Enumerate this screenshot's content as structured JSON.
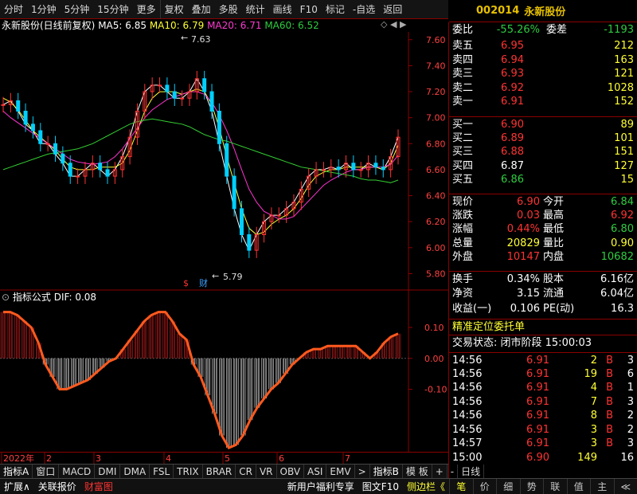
{
  "toolbar": {
    "items": [
      "分时",
      "1分钟",
      "5分钟",
      "15分钟",
      "更多",
      "复权",
      "叠加",
      "多股",
      "统计",
      "画线",
      "F10",
      "标记",
      "-自选",
      "返回"
    ]
  },
  "stock": {
    "code": "002014",
    "name": "永新股份"
  },
  "chart_header": {
    "title": "永新股份(日线前复权)",
    "ma5_label": "MA5: 6.85",
    "ma10_label": "MA10: 6.79",
    "ma20_label": "MA20: 6.71",
    "ma60_label": "MA60: 6.52"
  },
  "chart_annotations": {
    "high": "7.63",
    "low": "5.79",
    "marker_s": "$",
    "marker_cai": "财"
  },
  "indicator_header": {
    "label": "指标公式",
    "dif": "DIF: 0.08"
  },
  "colors": {
    "up": "#ff3333",
    "down": "#00d0ff",
    "ma5": "#ffffff",
    "ma10": "#ffff33",
    "ma20": "#ff33d0",
    "ma60": "#33cc33",
    "macd_pos": "#ff5a1e",
    "macd_neg": "#00a0ff"
  },
  "chart_data": {
    "type": "line",
    "y_ticks": [
      "7.60",
      "7.40",
      "7.20",
      "7.00",
      "6.80",
      "6.60",
      "6.40",
      "6.20",
      "6.00",
      "5.80"
    ],
    "ylim": [
      5.76,
      7.66
    ],
    "x_tick_labels": [
      "2022年",
      "2",
      "3",
      "4",
      "5",
      "6",
      "7"
    ],
    "series": [
      {
        "name": "MA5",
        "values": [
          7.1,
          7.13,
          7.05,
          6.95,
          6.9,
          6.8,
          6.8,
          6.72,
          6.65,
          6.55,
          6.55,
          6.6,
          6.65,
          6.6,
          6.55,
          6.6,
          6.7,
          6.85,
          7.05,
          7.2,
          7.25,
          7.25,
          7.2,
          7.15,
          7.15,
          7.2,
          7.3,
          7.2,
          7.05,
          6.8,
          6.55,
          6.3,
          6.1,
          5.98,
          6.1,
          6.2,
          6.25,
          6.25,
          6.3,
          6.35,
          6.45,
          6.55,
          6.6,
          6.6,
          6.62,
          6.6,
          6.65,
          6.6,
          6.6,
          6.65,
          6.62,
          6.6,
          6.7,
          6.85
        ]
      },
      {
        "name": "MA10",
        "values": [
          7.15,
          7.12,
          7.06,
          6.98,
          6.9,
          6.85,
          6.8,
          6.75,
          6.68,
          6.62,
          6.6,
          6.6,
          6.6,
          6.62,
          6.62,
          6.62,
          6.65,
          6.75,
          6.9,
          7.05,
          7.15,
          7.2,
          7.2,
          7.2,
          7.18,
          7.2,
          7.22,
          7.2,
          7.1,
          6.92,
          6.7,
          6.5,
          6.3,
          6.15,
          6.1,
          6.12,
          6.18,
          6.22,
          6.25,
          6.3,
          6.38,
          6.48,
          6.55,
          6.58,
          6.6,
          6.6,
          6.62,
          6.62,
          6.62,
          6.62,
          6.62,
          6.6,
          6.65,
          6.79
        ]
      },
      {
        "name": "MA20",
        "values": [
          7.05,
          7.0,
          6.96,
          6.92,
          6.88,
          6.84,
          6.8,
          6.76,
          6.72,
          6.68,
          6.66,
          6.65,
          6.64,
          6.65,
          6.66,
          6.7,
          6.76,
          6.84,
          6.92,
          7.0,
          7.06,
          7.1,
          7.14,
          7.16,
          7.18,
          7.2,
          7.2,
          7.18,
          7.12,
          7.02,
          6.9,
          6.76,
          6.6,
          6.45,
          6.35,
          6.28,
          6.25,
          6.22,
          6.22,
          6.24,
          6.3,
          6.36,
          6.42,
          6.48,
          6.52,
          6.55,
          6.58,
          6.6,
          6.6,
          6.62,
          6.62,
          6.62,
          6.64,
          6.71
        ]
      },
      {
        "name": "MA60",
        "values": [
          6.6,
          6.62,
          6.64,
          6.66,
          6.68,
          6.7,
          6.72,
          6.73,
          6.74,
          6.75,
          6.76,
          6.78,
          6.8,
          6.83,
          6.86,
          6.89,
          6.92,
          6.95,
          6.97,
          6.98,
          6.99,
          6.98,
          6.97,
          6.96,
          6.95,
          6.93,
          6.9,
          6.87,
          6.85,
          6.83,
          6.82,
          6.8,
          6.78,
          6.76,
          6.74,
          6.72,
          6.7,
          6.68,
          6.66,
          6.64,
          6.62,
          6.61,
          6.6,
          6.59,
          6.58,
          6.57,
          6.56,
          6.55,
          6.53,
          6.52,
          6.52,
          6.51,
          6.5,
          6.52
        ]
      }
    ]
  },
  "macd_data": {
    "type": "bar",
    "y_ticks": [
      "0.10",
      "0.00",
      "-0.10"
    ],
    "ylim": [
      -0.3,
      0.18
    ],
    "values": [
      0.15,
      0.15,
      0.14,
      0.12,
      0.1,
      0.05,
      -0.02,
      -0.06,
      -0.1,
      -0.1,
      -0.09,
      -0.08,
      -0.07,
      -0.05,
      -0.03,
      -0.01,
      0.0,
      0.03,
      0.06,
      0.09,
      0.12,
      0.14,
      0.15,
      0.15,
      0.12,
      0.08,
      0.06,
      -0.02,
      -0.06,
      -0.12,
      -0.18,
      -0.25,
      -0.29,
      -0.28,
      -0.25,
      -0.2,
      -0.16,
      -0.13,
      -0.1,
      -0.08,
      -0.05,
      -0.02,
      0.0,
      0.02,
      0.03,
      0.03,
      0.04,
      0.04,
      0.04,
      0.04,
      0.04,
      0.02,
      0.0,
      0.02,
      0.05,
      0.07,
      0.08
    ]
  },
  "right": {
    "weibi_label": "委比",
    "weibi": "-55.26%",
    "weicha_label": "委差",
    "weicha": "-1193",
    "asks": [
      {
        "label": "卖五",
        "price": "6.95",
        "vol": "212"
      },
      {
        "label": "卖四",
        "price": "6.94",
        "vol": "163"
      },
      {
        "label": "卖三",
        "price": "6.93",
        "vol": "121"
      },
      {
        "label": "卖二",
        "price": "6.92",
        "vol": "1028"
      },
      {
        "label": "卖一",
        "price": "6.91",
        "vol": "152"
      }
    ],
    "bids": [
      {
        "label": "买一",
        "price": "6.90",
        "vol": "89"
      },
      {
        "label": "买二",
        "price": "6.89",
        "vol": "101"
      },
      {
        "label": "买三",
        "price": "6.88",
        "vol": "151"
      },
      {
        "label": "买四",
        "price": "6.87",
        "vol": "127"
      },
      {
        "label": "买五",
        "price": "6.86",
        "vol": "15"
      }
    ],
    "quote": [
      {
        "l1": "现价",
        "v1": "6.90",
        "l2": "今开",
        "v2": "6.84"
      },
      {
        "l1": "涨跌",
        "v1": "0.03",
        "l2": "最高",
        "v2": "6.92"
      },
      {
        "l1": "涨幅",
        "v1": "0.44%",
        "l2": "最低",
        "v2": "6.80"
      },
      {
        "l1": "总量",
        "v1": "20829",
        "l2": "量比",
        "v2": "0.90"
      },
      {
        "l1": "外盘",
        "v1": "10147",
        "l2": "内盘",
        "v2": "10682"
      }
    ],
    "fin": [
      {
        "l1": "换手",
        "v1": "0.34%",
        "l2": "股本",
        "v2": "6.16亿"
      },
      {
        "l1": "净资",
        "v1": "3.15",
        "l2": "流通",
        "v2": "6.04亿"
      },
      {
        "l1": "收益(一)",
        "v1": "0.106",
        "l2": "PE(动)",
        "v2": "16.3"
      }
    ],
    "precise": "精准定位委托单",
    "trade_status": "交易状态: 闭市阶段 15:00:03",
    "ticks": [
      {
        "t": "14:56",
        "p": "6.91",
        "v": "2",
        "d": "B",
        "n": "3"
      },
      {
        "t": "14:56",
        "p": "6.91",
        "v": "19",
        "d": "B",
        "n": "6"
      },
      {
        "t": "14:56",
        "p": "6.91",
        "v": "4",
        "d": "B",
        "n": "1"
      },
      {
        "t": "14:56",
        "p": "6.91",
        "v": "7",
        "d": "B",
        "n": "3"
      },
      {
        "t": "14:56",
        "p": "6.91",
        "v": "8",
        "d": "B",
        "n": "2"
      },
      {
        "t": "14:56",
        "p": "6.91",
        "v": "3",
        "d": "B",
        "n": "2"
      },
      {
        "t": "14:57",
        "p": "6.91",
        "v": "3",
        "d": "B",
        "n": "3"
      },
      {
        "t": "15:00",
        "p": "6.90",
        "v": "149",
        "d": "",
        "n": "16"
      }
    ]
  },
  "indicator_tabs": [
    "指标A",
    "窗口",
    "MACD",
    "DMI",
    "DMA",
    "FSL",
    "TRIX",
    "BRAR",
    "CR",
    "VR",
    "OBV",
    "ASI",
    "EMV",
    ">",
    "指标B",
    "模 板",
    "+",
    "-",
    "日线"
  ],
  "bottom": {
    "left": [
      "扩展∧",
      "关联报价",
      "财富图"
    ],
    "mid": [
      "新用户福利专享",
      "图文F10",
      "侧边栏《"
    ],
    "right": [
      "笔",
      "价",
      "细",
      "势",
      "联",
      "值",
      "主",
      "≪"
    ]
  }
}
